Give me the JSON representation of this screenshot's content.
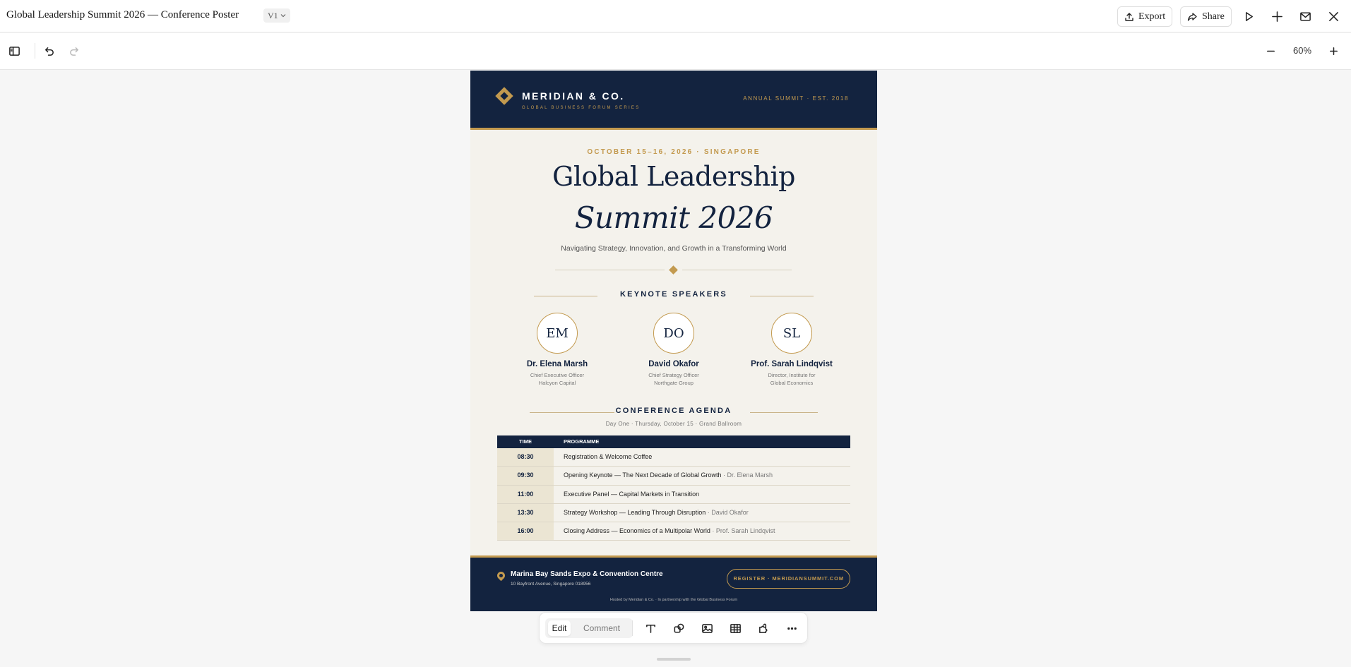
{
  "app": {
    "doc_title": "Global Leadership Summit 2026 — Conference Poster",
    "version": "V1",
    "export_label": "Export",
    "share_label": "Share",
    "zoom": "60%"
  },
  "poster": {
    "brand": "MERIDIAN & CO.",
    "brand_sub": "GLOBAL BUSINESS FORUM SERIES",
    "annual": "ANNUAL SUMMIT · EST. 2018",
    "date_line": "OCTOBER 15–16, 2026 · SINGAPORE",
    "title_line1": "Global Leadership",
    "title_line2": "Summit 2026",
    "tagline": "Navigating Strategy, Innovation, and Growth in a Transforming World",
    "keynote_title": "KEYNOTE SPEAKERS",
    "speakers": [
      {
        "initials": "EM",
        "name": "Dr. Elena Marsh",
        "role1": "Chief Executive Officer",
        "role2": "Halcyon Capital"
      },
      {
        "initials": "DO",
        "name": "David Okafor",
        "role1": "Chief Strategy Officer",
        "role2": "Northgate Group"
      },
      {
        "initials": "SL",
        "name": "Prof. Sarah Lindqvist",
        "role1": "Director, Institute for",
        "role2": "Global Economics"
      }
    ],
    "agenda_title": "CONFERENCE AGENDA",
    "agenda_sub": "Day One · Thursday, October 15 · Grand Ballroom",
    "agenda_headers": {
      "time": "TIME",
      "programme": "PROGRAMME"
    },
    "agenda": [
      {
        "time": "08:30",
        "item": "Registration & Welcome Coffee",
        "speaker": ""
      },
      {
        "time": "09:30",
        "item": "Opening Keynote — The Next Decade of Global Growth",
        "speaker": " · Dr. Elena Marsh"
      },
      {
        "time": "11:00",
        "item": "Executive Panel — Capital Markets in Transition",
        "speaker": ""
      },
      {
        "time": "13:30",
        "item": "Strategy Workshop — Leading Through Disruption",
        "speaker": " · David Okafor"
      },
      {
        "time": "16:00",
        "item": "Closing Address — Economics of a Multipolar World",
        "speaker": " · Prof. Sarah Lindqvist"
      }
    ],
    "venue": "Marina Bay Sands Expo & Convention Centre",
    "venue_address": "10 Bayfront Avenue, Singapore 018956",
    "register": "REGISTER · MERIDIANSUMMIT.COM",
    "hosted": "Hosted by Meridian & Co. · In partnership with the Global Business Forum"
  },
  "edit_bar": {
    "edit_label": "Edit",
    "comment_label": "Comment"
  },
  "colors": {
    "navy": "#13233f",
    "gold": "#c39a4f",
    "paper": "#f4f2ec"
  }
}
